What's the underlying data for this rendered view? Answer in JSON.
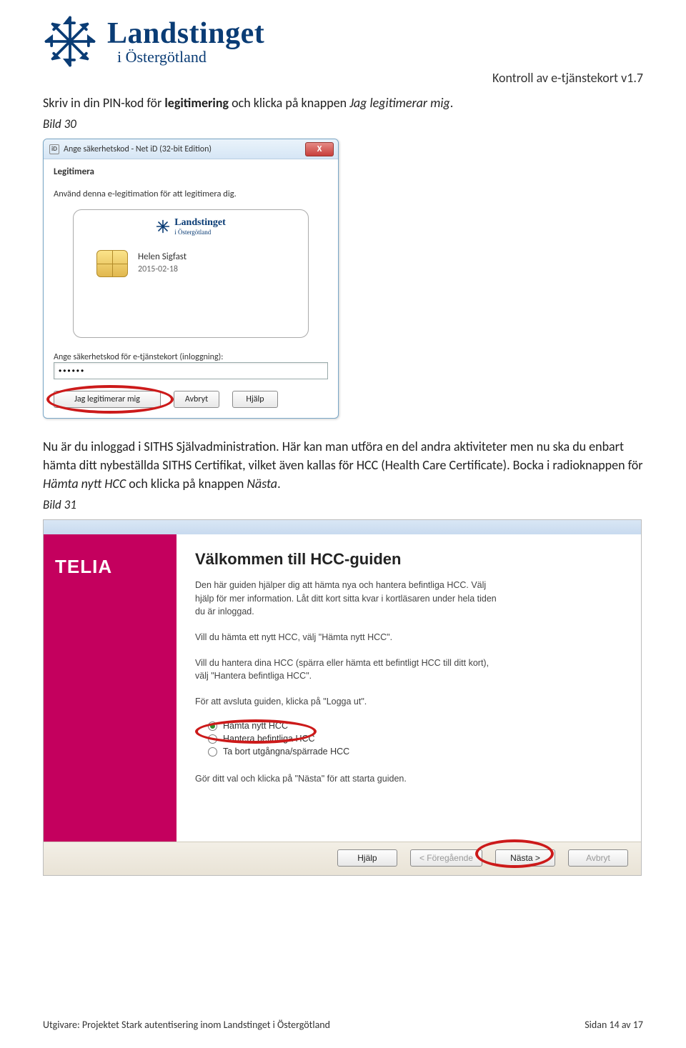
{
  "header": {
    "brand": "Landstinget",
    "subbrand": "i Östergötland",
    "doc_title": "Kontroll av e-tjänstekort v1.7"
  },
  "intro": {
    "pre": "Skriv in din PIN-kod för ",
    "bold": "legitimering",
    "mid": " och klicka på knappen ",
    "ital": "Jag legitimerar mig",
    "post": "."
  },
  "caption1": "Bild 30",
  "dlg1": {
    "title": "Ange säkerhetskod - Net iD (32-bit Edition)",
    "id_badge": "iD",
    "close": "X",
    "heading": "Legitimera",
    "sub": "Använd denna e-legitimation för att legitimera dig.",
    "card_brand": "Landstinget",
    "card_sub": "i Östergötland",
    "card_name": "Helen Sigfast",
    "card_date": "2015-02-18",
    "pw_label": "Ange säkerhetskod för e-tjänstekort (inloggning):",
    "pw_value": "••••••",
    "btn_ok": "Jag legitimerar mig",
    "btn_cancel": "Avbryt",
    "btn_help": "Hjälp"
  },
  "para2": {
    "l1": "Nu är du inloggad i SITHS Självadministration. Här kan man utföra en del andra aktiviteter men nu ska du enbart hämta ditt nybeställda SITHS Certifikat, vilket även kallas för HCC (Health Care Certificate). Bocka i radioknappen för ",
    "ital1": "Hämta nytt HCC",
    "mid": " och klicka på knappen ",
    "ital2": "Nästa",
    "post": "."
  },
  "caption2": "Bild 31",
  "hcc": {
    "side_brand": "TELIA",
    "heading": "Välkommen till HCC-guiden",
    "p1": "Den här guiden hjälper dig att hämta nya och hantera befintliga HCC. Välj hjälp för mer information. Låt ditt kort sitta kvar i kortläsaren under hela tiden du är inloggad.",
    "p2": "Vill du hämta ett nytt HCC, välj \"Hämta nytt HCC\".",
    "p3": "Vill du hantera dina HCC (spärra eller hämta ett befintligt HCC till ditt kort), välj \"Hantera befintliga HCC\".",
    "p4": "För att avsluta guiden, klicka på \"Logga ut\".",
    "r1": "Hämta nytt HCC",
    "r2": "Hantera befintliga HCC",
    "r3": "Ta bort utgångna/spärrade HCC",
    "p5": "Gör ditt val och klicka på \"Nästa\" för att starta guiden.",
    "btn_help": "Hjälp",
    "btn_prev": "< Föregående",
    "btn_next": "Nästa >",
    "btn_cancel": "Avbryt"
  },
  "footer": {
    "left": "Utgivare: Projektet Stark autentisering inom Landstinget i Östergötland",
    "right": "Sidan 14 av 17"
  }
}
